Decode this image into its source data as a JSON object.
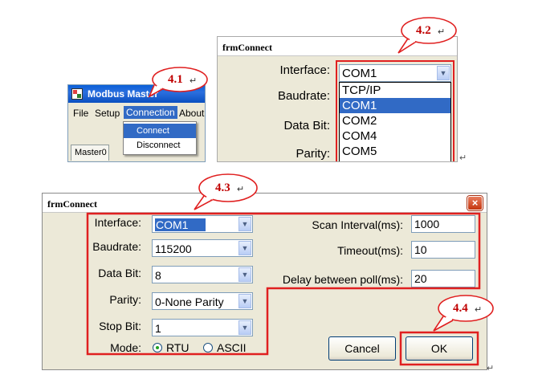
{
  "callouts": {
    "c41": "4.1",
    "c42": "4.2",
    "c43": "4.3",
    "c44": "4.4"
  },
  "return_mark": "↵",
  "menu_window": {
    "title": "Modbus Master",
    "menu": [
      "File",
      "Setup",
      "Connection",
      "About"
    ],
    "dropdown": [
      "Connect",
      "Disconnect"
    ],
    "tab": "Master0"
  },
  "small_form": {
    "title": "frmConnect",
    "labels": {
      "interface": "Interface:",
      "baudrate": "Baudrate:",
      "data_bit": "Data Bit:",
      "parity": "Parity:"
    },
    "interface_value": "COM1",
    "options": [
      "TCP/IP",
      "COM1",
      "COM2",
      "COM4",
      "COM5"
    ],
    "selected_option": "COM1"
  },
  "large_form": {
    "title": "frmConnect",
    "labels": {
      "interface": "Interface:",
      "baudrate": "Baudrate:",
      "data_bit": "Data Bit:",
      "parity": "Parity:",
      "stop_bit": "Stop Bit:",
      "mode": "Mode:",
      "scan_interval": "Scan Interval(ms):",
      "timeout": "Timeout(ms):",
      "delay": "Delay between poll(ms):"
    },
    "values": {
      "interface": "COM1",
      "baudrate": "115200",
      "data_bit": "8",
      "parity": "0-None Parity",
      "stop_bit": "1",
      "scan_interval": "1000",
      "timeout": "10",
      "delay": "20"
    },
    "mode_options": [
      "RTU",
      "ASCII"
    ],
    "mode_selected": "RTU",
    "buttons": {
      "cancel": "Cancel",
      "ok": "OK"
    }
  },
  "colors": {
    "highlight": "#c00000",
    "outline": "#e02020",
    "selection": "#316ac5",
    "dialog_bg": "#ece9d8"
  }
}
